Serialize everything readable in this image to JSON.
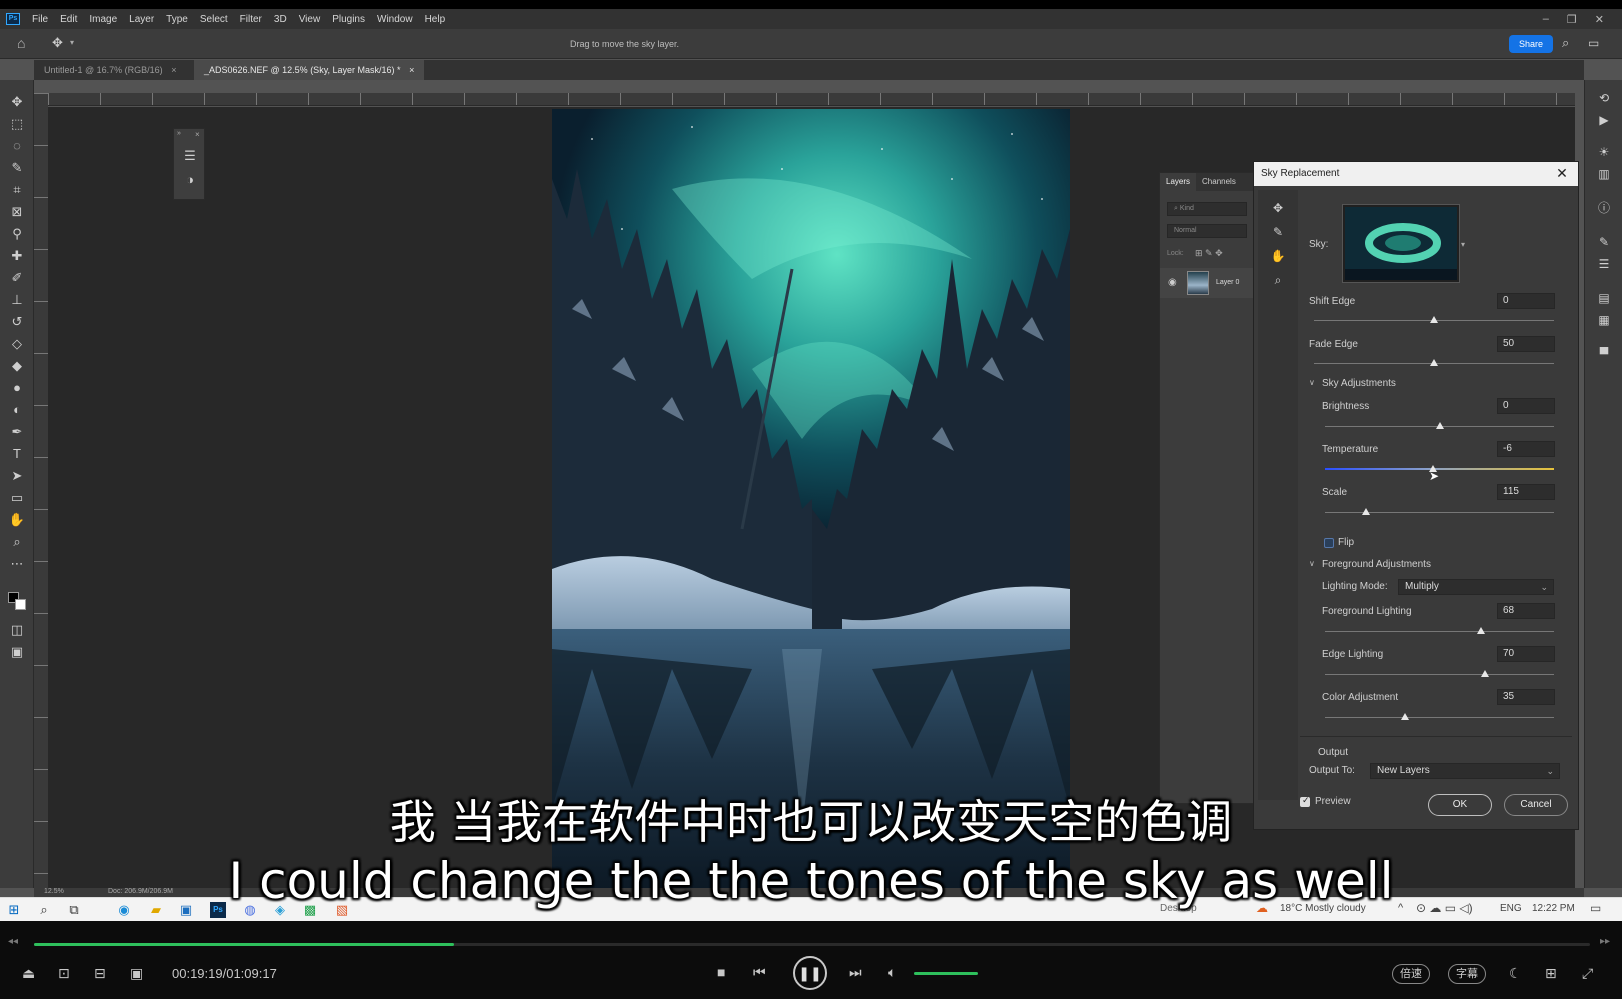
{
  "menubar": {
    "logo": "Ps",
    "items": [
      "File",
      "Edit",
      "Image",
      "Layer",
      "Type",
      "Select",
      "Filter",
      "3D",
      "View",
      "Plugins",
      "Window",
      "Help"
    ]
  },
  "options_bar": {
    "hint": "Drag to move the sky layer.",
    "share_label": "Share"
  },
  "doc_tabs": [
    {
      "label": "Untitled-1 @ 16.7% (RGB/16)"
    },
    {
      "label": "_ADS0626.NEF @ 12.5% (Sky, Layer Mask/16) *"
    }
  ],
  "status": {
    "zoom": "12.5%",
    "doc": "Doc: 206.9M/206.9M"
  },
  "layers_panel": {
    "tabs": [
      "Layers",
      "Channels"
    ],
    "kind_placeholder": "Kind",
    "blend_mode": "Normal",
    "lock_label": "Lock:",
    "layer_name": "Layer 0"
  },
  "sky_dialog": {
    "title": "Sky Replacement",
    "sky_label": "Sky:",
    "shift_edge": {
      "label": "Shift Edge",
      "value": "0",
      "pos": 0.5
    },
    "fade_edge": {
      "label": "Fade Edge",
      "value": "50",
      "pos": 0.5
    },
    "sky_adjustments_label": "Sky Adjustments",
    "brightness": {
      "label": "Brightness",
      "value": "0",
      "pos": 0.5
    },
    "temperature": {
      "label": "Temperature",
      "value": "-6",
      "pos": 0.47
    },
    "scale": {
      "label": "Scale",
      "value": "115",
      "pos": 0.18
    },
    "flip_label": "Flip",
    "foreground_adjustments_label": "Foreground Adjustments",
    "lighting_mode": {
      "label": "Lighting Mode:",
      "value": "Multiply"
    },
    "foreground_lighting": {
      "label": "Foreground Lighting",
      "value": "68",
      "pos": 0.68
    },
    "edge_lighting": {
      "label": "Edge Lighting",
      "value": "70",
      "pos": 0.7
    },
    "color_adjustment": {
      "label": "Color Adjustment",
      "value": "35",
      "pos": 0.35
    },
    "output_label": "Output",
    "output_to": {
      "label": "Output To:",
      "value": "New Layers"
    },
    "preview_label": "Preview",
    "ok_label": "OK",
    "cancel_label": "Cancel"
  },
  "taskbar": {
    "desktop_label": "Desktop",
    "weather": "18°C  Mostly cloudy",
    "language": "ENG",
    "clock": "12:22 PM"
  },
  "player": {
    "time": "00:19:19/01:09:17",
    "progress": 0.27,
    "speed_label": "倍速",
    "subtitle_label": "字幕"
  },
  "subtitles": {
    "chinese": "我 当我在软件中时也可以改变天空的色调",
    "english": "I could change the the tones of the sky as well"
  }
}
